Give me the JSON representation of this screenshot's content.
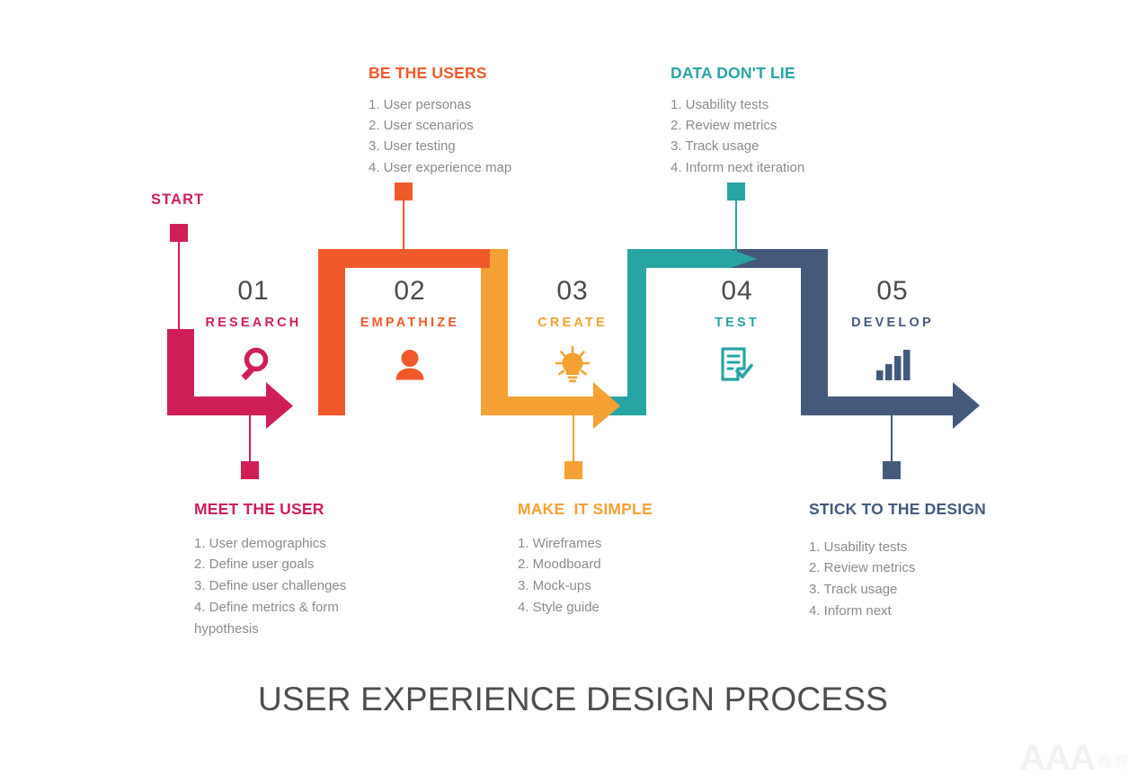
{
  "title": "USER EXPERIENCE DESIGN PROCESS",
  "start_label": "START",
  "colors": {
    "pink": "#CF1F56",
    "orange": "#F05A2A",
    "amber": "#F5A133",
    "teal": "#27A5A5",
    "navy": "#435A7C",
    "number": "#4B4B4B",
    "body_text": "#8A8A8A",
    "title_text": "#4D4D4D"
  },
  "steps": [
    {
      "number": "01",
      "name": "RESEARCH",
      "color": "#CF1F56",
      "icon": "magnifier-icon"
    },
    {
      "number": "02",
      "name": "EMPATHIZE",
      "color": "#F05A2A",
      "icon": "user-icon"
    },
    {
      "number": "03",
      "name": "CREATE",
      "color": "#F5A133",
      "icon": "lightbulb-icon"
    },
    {
      "number": "04",
      "name": "TEST",
      "color": "#27A5A5",
      "icon": "checklist-icon"
    },
    {
      "number": "05",
      "name": "DEVELOP",
      "color": "#435A7C",
      "icon": "bar-chart-icon"
    }
  ],
  "callouts_top": [
    {
      "title": "BE THE USERS",
      "color": "#F05A2A",
      "items": [
        "1. User personas",
        "2. User scenarios",
        "3. User testing",
        "4. User experience map"
      ]
    },
    {
      "title": "DATA DON'T LIE",
      "color": "#27A5A5",
      "items": [
        "1. Usability tests",
        "2. Review metrics",
        "3. Track usage",
        "4. Inform next iteration"
      ]
    }
  ],
  "callouts_bottom": [
    {
      "title": "MEET THE USER",
      "color": "#CF1F56",
      "items": [
        "1. User demographics",
        "2. Define user goals",
        "3. Define user challenges",
        "4. Define metrics & form",
        "hypothesis"
      ]
    },
    {
      "title": "MAKE  IT SIMPLE",
      "color": "#F5A133",
      "items": [
        "1. Wireframes",
        "2. Moodboard",
        "3. Mock-ups",
        "4. Style guide"
      ]
    },
    {
      "title": "STICK TO THE DESIGN",
      "color": "#435A7C",
      "items": [
        "1. Usability tests",
        "2. Review metrics",
        "3. Track usage",
        "4. Inform next"
      ]
    }
  ],
  "watermark": {
    "letters": "AAA",
    "suffix": "教育"
  }
}
